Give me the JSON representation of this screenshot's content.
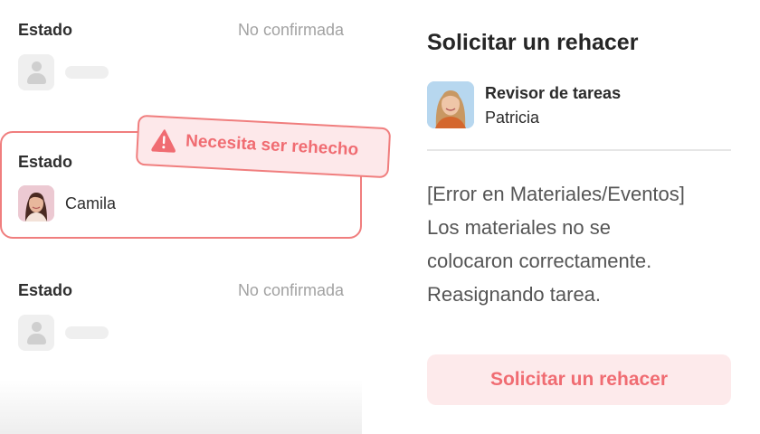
{
  "task_list": {
    "rows": [
      {
        "label": "Estado",
        "status": "No confirmada"
      },
      {
        "label": "Estado",
        "assignee": "Camila",
        "badge": "Necesita ser rehecho"
      },
      {
        "label": "Estado",
        "status": "No confirmada"
      }
    ]
  },
  "panel": {
    "title": "Solicitar un rehacer",
    "reviewer_role": "Revisor de tareas",
    "reviewer_name": "Patricia",
    "message_lines": [
      "[Error en Materiales/Eventos]",
      "Los materiales no se",
      "colocaron correctamente.",
      "Reasignando tarea."
    ],
    "button_label": "Solicitar un rehacer"
  },
  "colors": {
    "accent": "#f06c72",
    "accent_bg": "#fde8ea",
    "border_accent": "#f07e7e",
    "muted_text": "#a2a2a2"
  },
  "icons": [
    "user-placeholder-icon",
    "warning-triangle-icon"
  ]
}
